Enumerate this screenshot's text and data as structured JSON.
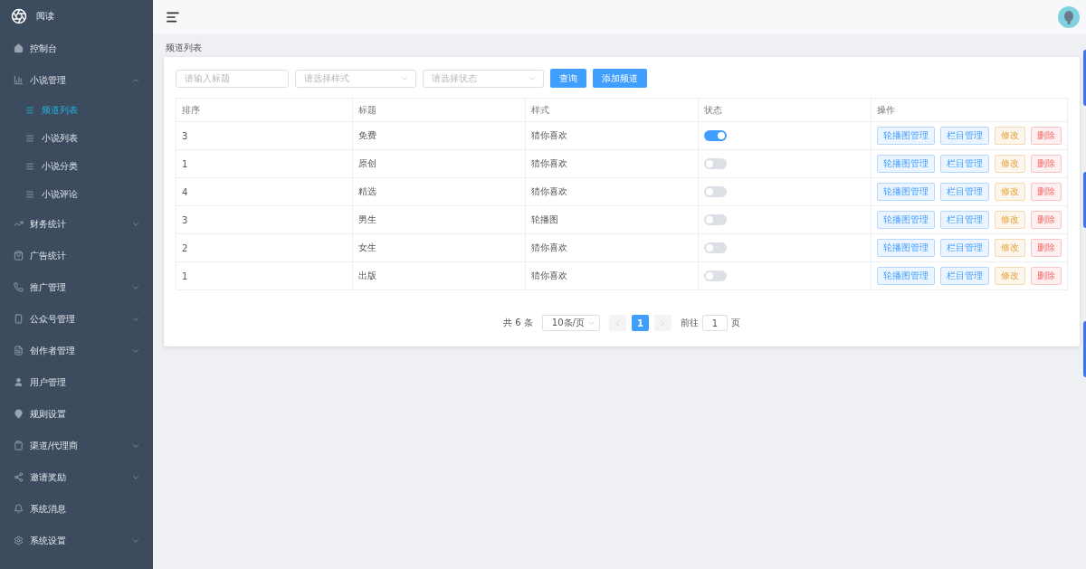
{
  "app": {
    "title": "阅读"
  },
  "sidebar": {
    "items": [
      {
        "label": "控制台",
        "kind": "link"
      },
      {
        "label": "小说管理",
        "kind": "group",
        "expanded": true,
        "children": [
          {
            "label": "频道列表",
            "selected": true
          },
          {
            "label": "小说列表",
            "selected": false
          },
          {
            "label": "小说分类",
            "selected": false
          },
          {
            "label": "小说评论",
            "selected": false
          }
        ]
      },
      {
        "label": "财务统计",
        "kind": "group",
        "expanded": false
      },
      {
        "label": "广告统计",
        "kind": "link"
      },
      {
        "label": "推广管理",
        "kind": "group",
        "expanded": false
      },
      {
        "label": "公众号管理",
        "kind": "group",
        "expanded": false
      },
      {
        "label": "创作者管理",
        "kind": "group",
        "expanded": false
      },
      {
        "label": "用户管理",
        "kind": "link"
      },
      {
        "label": "规则设置",
        "kind": "link"
      },
      {
        "label": "渠道/代理商",
        "kind": "group",
        "expanded": false
      },
      {
        "label": "邀请奖励",
        "kind": "group",
        "expanded": false
      },
      {
        "label": "系统消息",
        "kind": "link"
      },
      {
        "label": "系统设置",
        "kind": "group",
        "expanded": false
      }
    ]
  },
  "breadcrumb": "频道列表",
  "filters": {
    "title": {
      "placeholder": "请输入标题"
    },
    "style": {
      "placeholder": "请选择样式"
    },
    "status": {
      "placeholder": "请选择状态"
    },
    "buttons": [
      "查询",
      "添加频道"
    ]
  },
  "table": {
    "columns": [
      "排序",
      "标题",
      "样式",
      "状态",
      "操作"
    ],
    "rows": [
      {
        "order": "3",
        "title": "免费",
        "style": "猜你喜欢",
        "on": true,
        "actions": [
          {
            "label": "轮播图管理",
            "kind": "primary"
          },
          {
            "label": "栏目管理",
            "kind": "primary"
          },
          {
            "label": "修改",
            "kind": "warning"
          },
          {
            "label": "删除",
            "kind": "danger"
          }
        ]
      },
      {
        "order": "1",
        "title": "原创",
        "style": "猜你喜欢",
        "on": false,
        "actions": [
          {
            "label": "轮播图管理",
            "kind": "primary"
          },
          {
            "label": "栏目管理",
            "kind": "primary"
          },
          {
            "label": "修改",
            "kind": "warning"
          },
          {
            "label": "删除",
            "kind": "danger"
          }
        ]
      },
      {
        "order": "4",
        "title": "精选",
        "style": "猜你喜欢",
        "on": false,
        "actions": [
          {
            "label": "轮播图管理",
            "kind": "primary"
          },
          {
            "label": "栏目管理",
            "kind": "primary"
          },
          {
            "label": "修改",
            "kind": "warning"
          },
          {
            "label": "删除",
            "kind": "danger"
          }
        ]
      },
      {
        "order": "3",
        "title": "男生",
        "style": "轮播图",
        "on": false,
        "actions": [
          {
            "label": "轮播图管理",
            "kind": "primary"
          },
          {
            "label": "栏目管理",
            "kind": "primary"
          },
          {
            "label": "修改",
            "kind": "warning"
          },
          {
            "label": "删除",
            "kind": "danger"
          }
        ]
      },
      {
        "order": "2",
        "title": "女生",
        "style": "猜你喜欢",
        "on": false,
        "actions": [
          {
            "label": "轮播图管理",
            "kind": "primary"
          },
          {
            "label": "栏目管理",
            "kind": "primary"
          },
          {
            "label": "修改",
            "kind": "warning"
          },
          {
            "label": "删除",
            "kind": "danger"
          }
        ]
      },
      {
        "order": "1",
        "title": "出版",
        "style": "猜你喜欢",
        "on": false,
        "actions": [
          {
            "label": "轮播图管理",
            "kind": "primary"
          },
          {
            "label": "栏目管理",
            "kind": "primary"
          },
          {
            "label": "修改",
            "kind": "warning"
          },
          {
            "label": "删除",
            "kind": "danger"
          }
        ]
      }
    ]
  },
  "pagination": {
    "total": "共 6 条",
    "page_size": "10条/页",
    "pages": [
      {
        "label": "1",
        "selected": true
      }
    ],
    "goto_label": "前往",
    "goto_value": "1",
    "page_suffix": "页"
  }
}
